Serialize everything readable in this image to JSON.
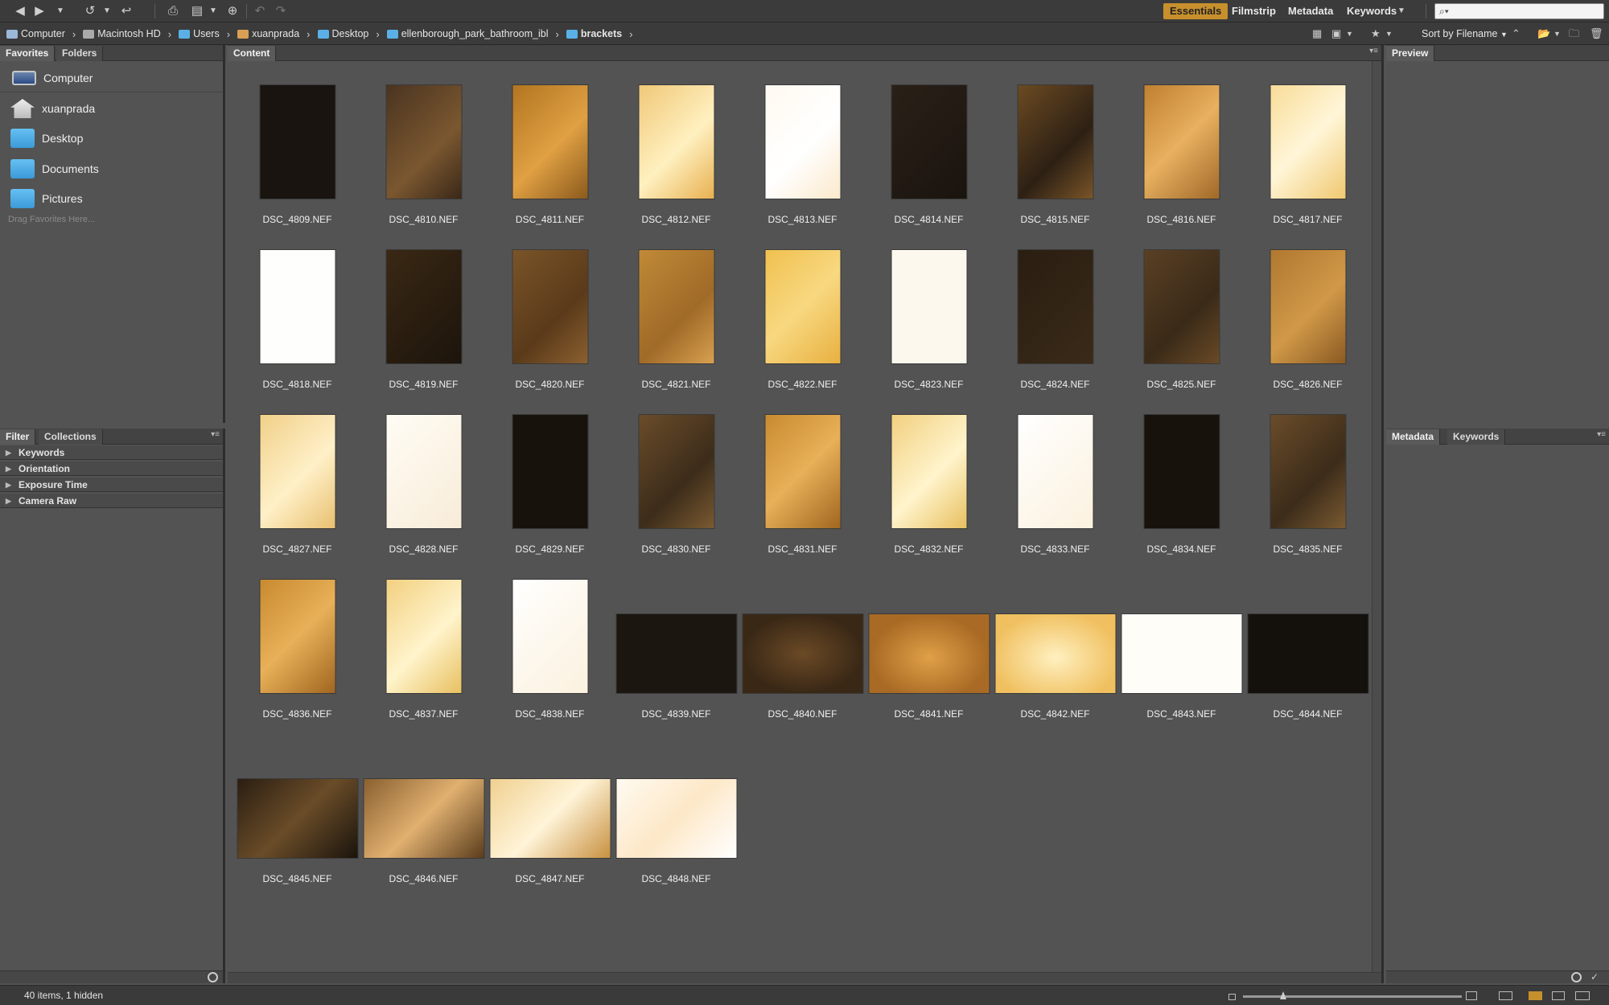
{
  "toolbar": {
    "workspaces": [
      "Essentials",
      "Filmstrip",
      "Metadata",
      "Keywords"
    ],
    "active_workspace": "Essentials",
    "search": {
      "value": "",
      "placeholder": ""
    }
  },
  "path": [
    {
      "label": "Computer",
      "icon": "computer-icon"
    },
    {
      "label": "Macintosh HD",
      "icon": "hard-drive-icon"
    },
    {
      "label": "Users",
      "icon": "folder-icon"
    },
    {
      "label": "xuanprada",
      "icon": "home-icon"
    },
    {
      "label": "Desktop",
      "icon": "folder-icon"
    },
    {
      "label": "ellenborough_park_bathroom_ibl",
      "icon": "folder-icon"
    },
    {
      "label": "brackets",
      "icon": "folder-icon"
    }
  ],
  "sort_label": "Sort by Filename",
  "left_top": {
    "tabs": [
      "Favorites",
      "Folders"
    ],
    "favorites": [
      {
        "label": "Computer",
        "icon": "computer-icon"
      },
      {
        "label": "xuanprada",
        "icon": "home-icon"
      },
      {
        "label": "Desktop",
        "icon": "folder-icon"
      },
      {
        "label": "Documents",
        "icon": "folder-icon"
      },
      {
        "label": "Pictures",
        "icon": "folder-icon"
      }
    ],
    "drag_hint": "Drag Favorites Here..."
  },
  "left_bottom": {
    "tabs": [
      "Filter",
      "Collections"
    ],
    "filters": [
      "Keywords",
      "Orientation",
      "Exposure Time",
      "Camera Raw"
    ]
  },
  "content": {
    "tab": "Content",
    "files": [
      "DSC_4809.NEF",
      "DSC_4810.NEF",
      "DSC_4811.NEF",
      "DSC_4812.NEF",
      "DSC_4813.NEF",
      "DSC_4814.NEF",
      "DSC_4815.NEF",
      "DSC_4816.NEF",
      "DSC_4817.NEF",
      "DSC_4818.NEF",
      "DSC_4819.NEF",
      "DSC_4820.NEF",
      "DSC_4821.NEF",
      "DSC_4822.NEF",
      "DSC_4823.NEF",
      "DSC_4824.NEF",
      "DSC_4825.NEF",
      "DSC_4826.NEF",
      "DSC_4827.NEF",
      "DSC_4828.NEF",
      "DSC_4829.NEF",
      "DSC_4830.NEF",
      "DSC_4831.NEF",
      "DSC_4832.NEF",
      "DSC_4833.NEF",
      "DSC_4834.NEF",
      "DSC_4835.NEF",
      "DSC_4836.NEF",
      "DSC_4837.NEF",
      "DSC_4838.NEF",
      "DSC_4839.NEF",
      "DSC_4840.NEF",
      "DSC_4841.NEF",
      "DSC_4842.NEF",
      "DSC_4843.NEF",
      "DSC_4844.NEF",
      "DSC_4845.NEF",
      "DSC_4846.NEF",
      "DSC_4847.NEF",
      "DSC_4848.NEF"
    ]
  },
  "right_top": {
    "tabs": [
      "Preview"
    ]
  },
  "right_bottom": {
    "tabs": [
      "Metadata",
      "Keywords"
    ]
  },
  "status": "40 items, 1 hidden",
  "colors": {
    "accent": "#c7902d",
    "panel": "#535353",
    "chrome": "#3b3b3b"
  }
}
